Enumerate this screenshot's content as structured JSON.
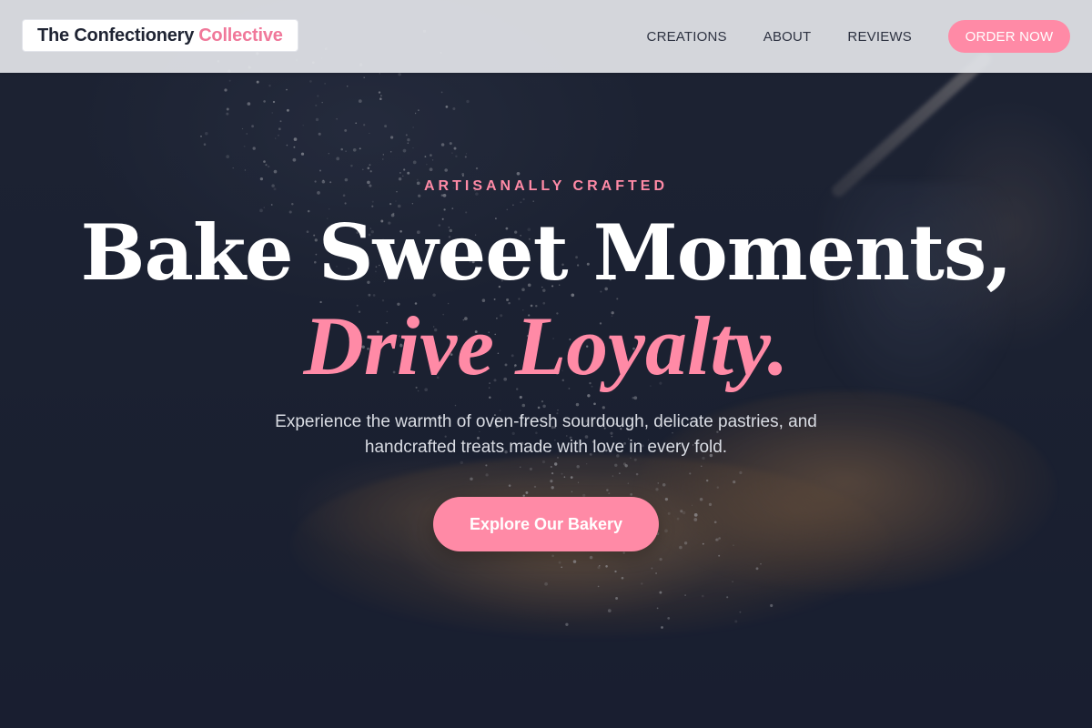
{
  "header": {
    "brand_name": "The Confectionery",
    "brand_accent": "Collective",
    "nav": {
      "creations": "CREATIONS",
      "about": "ABOUT",
      "reviews": "REVIEWS"
    },
    "order_button": "ORDER NOW"
  },
  "hero": {
    "eyebrow": "ARTISANALLY CRAFTED",
    "headline_line1": "Bake Sweet Moments,",
    "headline_line2": "Drive Loyalty.",
    "subtext": "Experience the warmth of oven-fresh sourdough, delicate pastries, and handcrafted treats made with love in every fold.",
    "cta_button": "Explore Our Bakery"
  },
  "colors": {
    "accent_pink": "#ff8aa6",
    "header_background": "#e2e4e8",
    "hero_background": "#1d2335",
    "headline_white": "#ffffff"
  }
}
